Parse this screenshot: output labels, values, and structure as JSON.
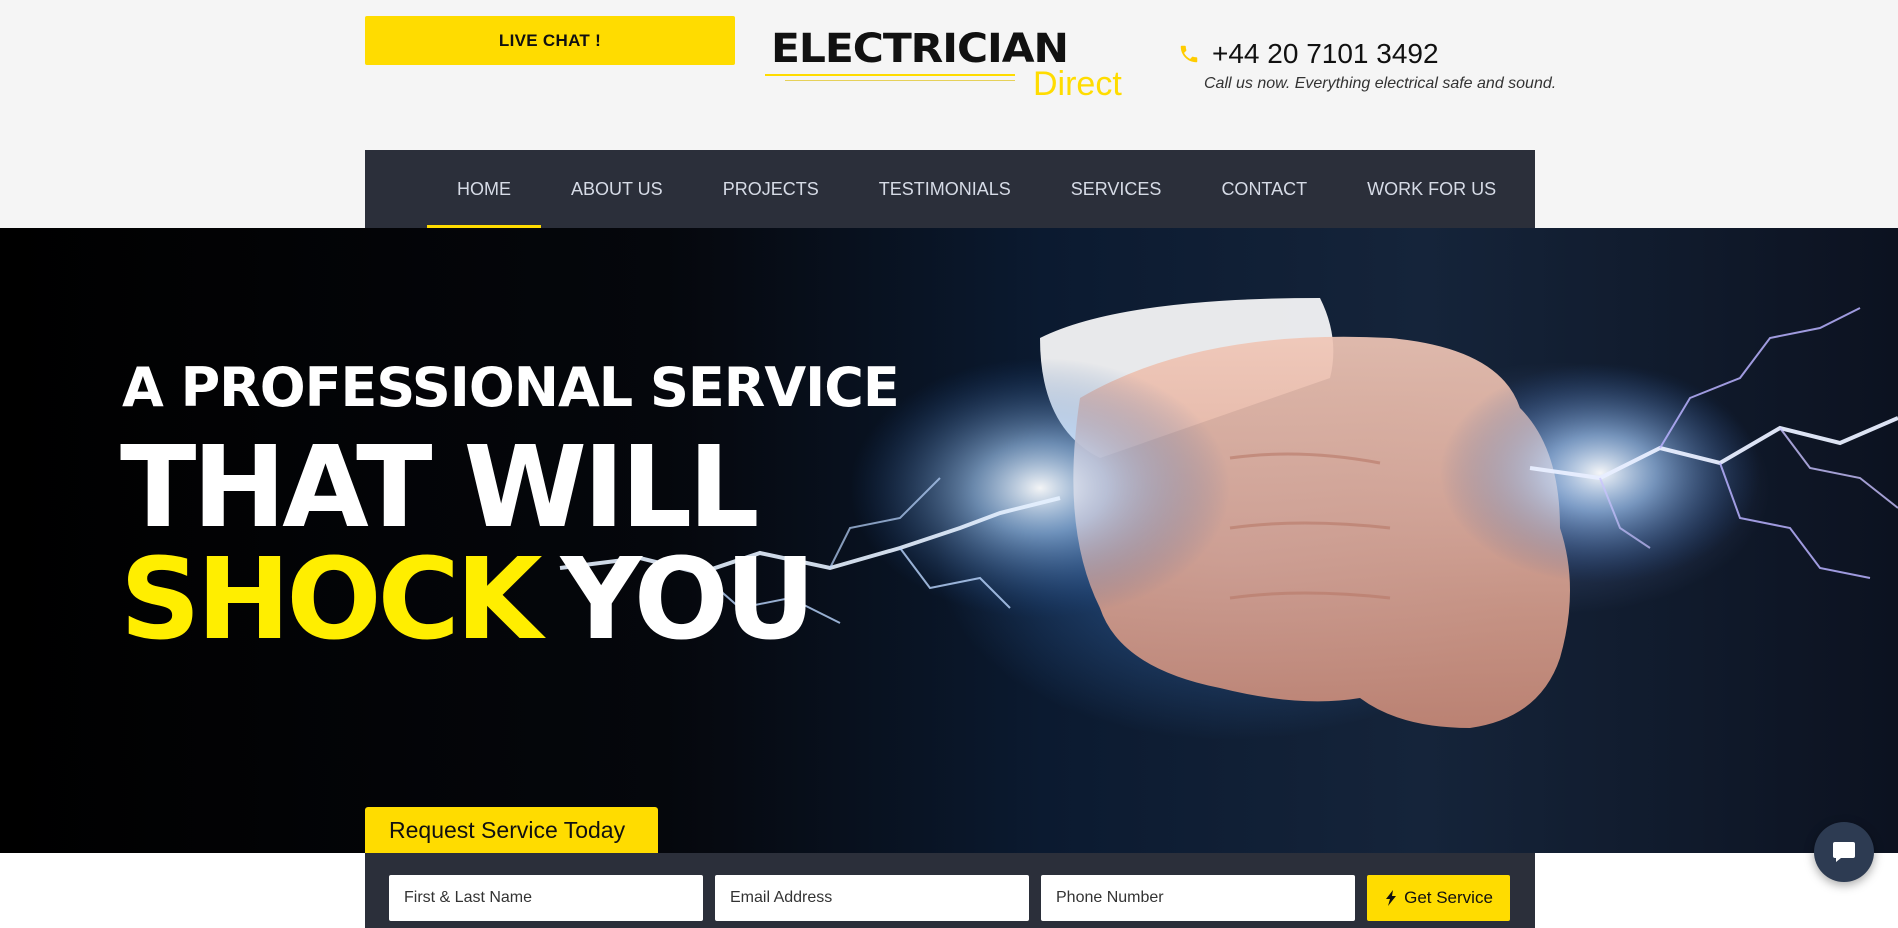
{
  "header": {
    "live_chat_label": "LIVE CHAT !",
    "logo": {
      "main": "ELECTRICIAN",
      "sub": "Direct"
    },
    "phone": "+44 20 7101 3492",
    "tagline": "Call us now. Everything electrical safe and sound."
  },
  "nav": {
    "items": [
      {
        "label": "HOME",
        "active": true
      },
      {
        "label": "ABOUT US"
      },
      {
        "label": "PROJECTS"
      },
      {
        "label": "TESTIMONIALS"
      },
      {
        "label": "SERVICES"
      },
      {
        "label": "CONTACT"
      },
      {
        "label": "WORK FOR US"
      }
    ]
  },
  "hero": {
    "line1": "A PROFESSIONAL SERVICE",
    "line2": "THAT WILL",
    "line3_highlight": "SHOCK",
    "line3_rest": "YOU"
  },
  "request": {
    "tab_label": "Request Service Today",
    "name_placeholder": "First & Last Name",
    "email_placeholder": "Email Address",
    "phone_placeholder": "Phone Number",
    "submit_label": "Get Service"
  },
  "icons": {
    "phone": "phone-icon",
    "bolt": "lightning-bolt-icon",
    "chat": "chat-bubble-icon"
  },
  "colors": {
    "accent": "#ffdc00",
    "nav_bg": "#2b2f3a",
    "chat_bg": "#2d3b52"
  }
}
